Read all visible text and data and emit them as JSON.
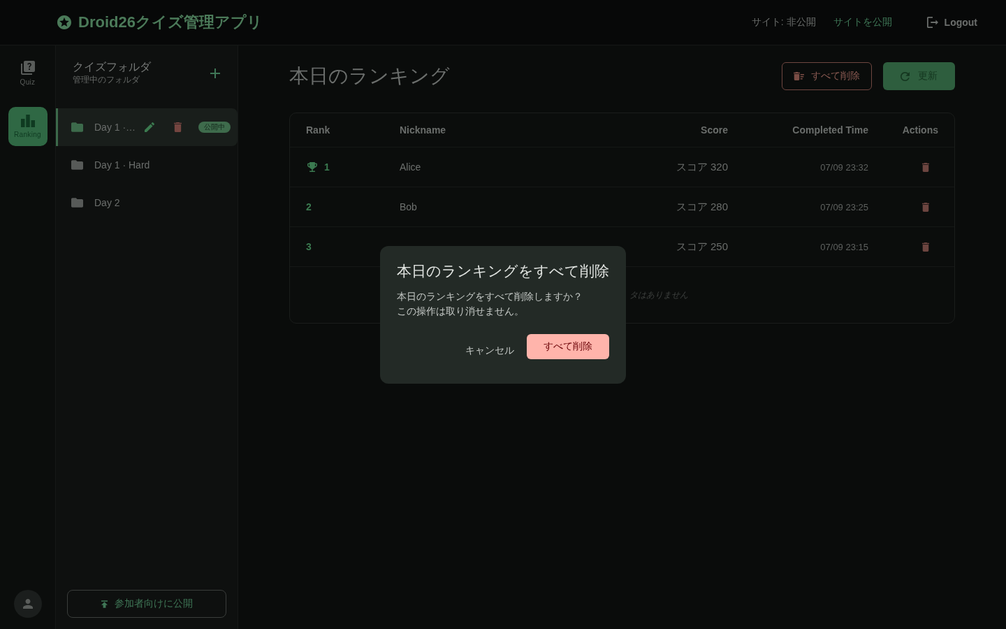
{
  "header": {
    "title": "Droid26クイズ管理アプリ",
    "site_status": "サイト: 非公開",
    "publish_link": "サイトを公開",
    "logout": "Logout"
  },
  "rail": {
    "items": [
      {
        "kind": "quiz",
        "label": "Quiz",
        "selected": false
      },
      {
        "kind": "ranking",
        "label": "Ranking",
        "selected": true
      }
    ]
  },
  "folders": {
    "title": "クイズフォルダ",
    "subtitle": "管理中のフォルダ",
    "items": [
      {
        "name": "Day 1 ·…",
        "selected": true,
        "badge": "公開中"
      },
      {
        "name": "Day 1 · Hard",
        "selected": false
      },
      {
        "name": "Day 2",
        "selected": false
      }
    ],
    "publish_button": "参加者向けに公開"
  },
  "main": {
    "title": "本日のランキング",
    "delete_all_button": "すべて削除",
    "refresh_button": "更新"
  },
  "table": {
    "columns": [
      "Rank",
      "Nickname",
      "Score",
      "Completed Time",
      "Actions"
    ],
    "rows": [
      {
        "rank": "1",
        "trophy": true,
        "nickname": "Alice",
        "score": "スコア 320",
        "time": "07/09 23:32"
      },
      {
        "rank": "2",
        "trophy": false,
        "nickname": "Bob",
        "score": "スコア 280",
        "time": "07/09 23:25"
      },
      {
        "rank": "3",
        "trophy": false,
        "score": "スコア 250",
        "time": "07/09 23:15"
      }
    ],
    "empty_message": "タはありません"
  },
  "dialog": {
    "title": "本日のランキングをすべて削除",
    "message": [
      "本日のランキングをすべて削除しますか？",
      "この操作は取り消せません。"
    ],
    "cancel": "キャンセル",
    "confirm": "すべて削除"
  }
}
